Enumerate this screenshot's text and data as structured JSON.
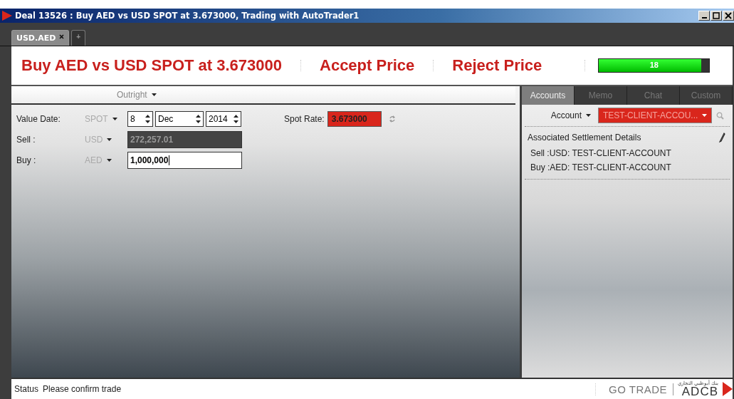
{
  "window": {
    "title": "Deal 13526 : Buy AED vs USD SPOT at 3.673000, Trading with AutoTrader1"
  },
  "tabs": [
    {
      "label": "USD.AED",
      "selected": true,
      "closable": true
    },
    {
      "label": "+",
      "selected": false,
      "closable": false
    }
  ],
  "header": {
    "deal": "Buy AED vs USD SPOT at 3.673000",
    "accept": "Accept Price",
    "reject": "Reject Price",
    "timer": {
      "label": "18",
      "level": 0.93
    }
  },
  "trade_type": {
    "value": "Outright"
  },
  "form": {
    "value_date": {
      "label": "Value Date:",
      "tenor": "SPOT",
      "day": "8",
      "month": "Dec",
      "year": "2014"
    },
    "spot_rate": {
      "label": "Spot Rate:",
      "value": "3.673000"
    },
    "sell": {
      "label": "Sell :",
      "currency": "USD",
      "amount": "272,257.01",
      "disabled": true
    },
    "buy": {
      "label": "Buy :",
      "currency": "AED",
      "amount": "1,000,000",
      "disabled": false
    }
  },
  "side_tabs": [
    {
      "label": "Accounts",
      "selected": true
    },
    {
      "label": "Memo",
      "selected": false
    },
    {
      "label": "Chat",
      "selected": false
    },
    {
      "label": "Custom",
      "selected": false
    }
  ],
  "account": {
    "label": "Account",
    "value": "TEST-CLIENT-ACCOU..."
  },
  "settlement": {
    "title": "Associated Settlement Details",
    "lines": [
      "Sell :USD: TEST-CLIENT-ACCOUNT",
      "Buy :AED: TEST-CLIENT-ACCOUNT"
    ]
  },
  "status_bar": {
    "label": "Status",
    "message": "Please confirm trade",
    "go_trade": "GO TRADE",
    "logo_arabic": "بنك أبوظبي التجاري",
    "logo": "ADCB"
  }
}
